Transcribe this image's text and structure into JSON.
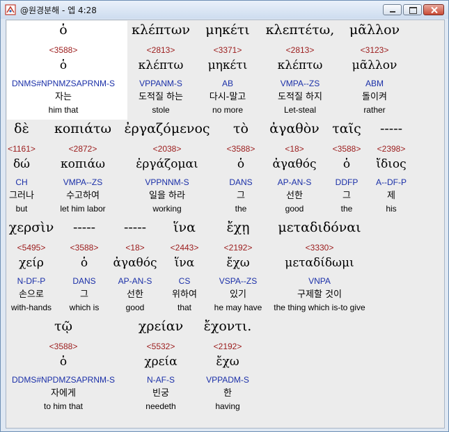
{
  "window": {
    "title": "@원경분해 - 엡 4:28"
  },
  "words": [
    {
      "greek": "ὁ",
      "num": "<3588>",
      "lemma": "ὁ",
      "parse": "DNMS#NPNMZSAPRNM-S",
      "kor": "자는",
      "eng": "him that"
    },
    {
      "greek": "κλέπτων",
      "num": "<2813>",
      "lemma": "κλέπτω",
      "parse": "VPPANM-S",
      "kor": "도적질 하는",
      "eng": "stole"
    },
    {
      "greek": "μηκέτι",
      "num": "<3371>",
      "lemma": "μηκέτι",
      "parse": "AB",
      "kor": "다시-말고",
      "eng": "no more"
    },
    {
      "greek": "κλεπτέτω,",
      "num": "<2813>",
      "lemma": "κλέπτω",
      "parse": "VMPA--ZS",
      "kor": "도적질 하지",
      "eng": "Let-steal"
    },
    {
      "greek": "μᾶλλον",
      "num": "<3123>",
      "lemma": "μᾶλλον",
      "parse": "ABM",
      "kor": "돌이켜",
      "eng": "rather"
    },
    {
      "greek": "δὲ",
      "num": "<1161>",
      "lemma": "δώ",
      "parse": "CH",
      "kor": "그러나",
      "eng": "but"
    },
    {
      "greek": "κοπιάτω",
      "num": "<2872>",
      "lemma": "κοπιάω",
      "parse": "VMPA--ZS",
      "kor": "수고하여",
      "eng": "let him labor"
    },
    {
      "greek": "ἐργαζόμενος",
      "num": "<2038>",
      "lemma": "ἐργάζομαι",
      "parse": "VPPNNM-S",
      "kor": "일을 하라",
      "eng": "working"
    },
    {
      "greek": "τὸ",
      "num": "<3588>",
      "lemma": "ὁ",
      "parse": "DANS",
      "kor": "그",
      "eng": "the"
    },
    {
      "greek": "ἀγαθὸν",
      "num": "<18>",
      "lemma": "ἀγαθός",
      "parse": "AP-AN-S",
      "kor": "선한",
      "eng": "good"
    },
    {
      "greek": "ταῖς",
      "num": "<3588>",
      "lemma": "ὁ",
      "parse": "DDFP",
      "kor": "그",
      "eng": "the"
    },
    {
      "greek": "-----",
      "num": "<2398>",
      "lemma": "ἴδιος",
      "parse": "A--DF-P",
      "kor": "제",
      "eng": "his"
    },
    {
      "greek": "χερσὶν",
      "num": "<5495>",
      "lemma": "χείρ",
      "parse": "N-DF-P",
      "kor": "손으로",
      "eng": "with-hands"
    },
    {
      "greek": "-----",
      "num": "<3588>",
      "lemma": "ὁ",
      "parse": "DANS",
      "kor": "그",
      "eng": "which is"
    },
    {
      "greek": "-----",
      "num": "<18>",
      "lemma": "ἀγαθός",
      "parse": "AP-AN-S",
      "kor": "선한",
      "eng": "good"
    },
    {
      "greek": "ἵνα",
      "num": "<2443>",
      "lemma": "ἵνα",
      "parse": "CS",
      "kor": "위하여",
      "eng": "that"
    },
    {
      "greek": "ἔχῃ",
      "num": "<2192>",
      "lemma": "ἔχω",
      "parse": "VSPA--ZS",
      "kor": "있기",
      "eng": "he may have"
    },
    {
      "greek": "μεταδιδόναι",
      "num": "<3330>",
      "lemma": "μεταδίδωμι",
      "parse": "VNPA",
      "kor": "구제할 것이",
      "eng": "the thing which is-to give"
    },
    {
      "greek": "τῷ",
      "num": "<3588>",
      "lemma": "ὁ",
      "parse": "DDMS#NPDMZSAPRNM-S",
      "kor": "자에게",
      "eng": "to him that"
    },
    {
      "greek": "χρείαν",
      "num": "<5532>",
      "lemma": "χρεία",
      "parse": "N-AF-S",
      "kor": "빈궁",
      "eng": "needeth"
    },
    {
      "greek": "ἔχοντι.",
      "num": "<2192>",
      "lemma": "ἔχω",
      "parse": "VPPADM-S",
      "kor": "한",
      "eng": "having"
    }
  ]
}
